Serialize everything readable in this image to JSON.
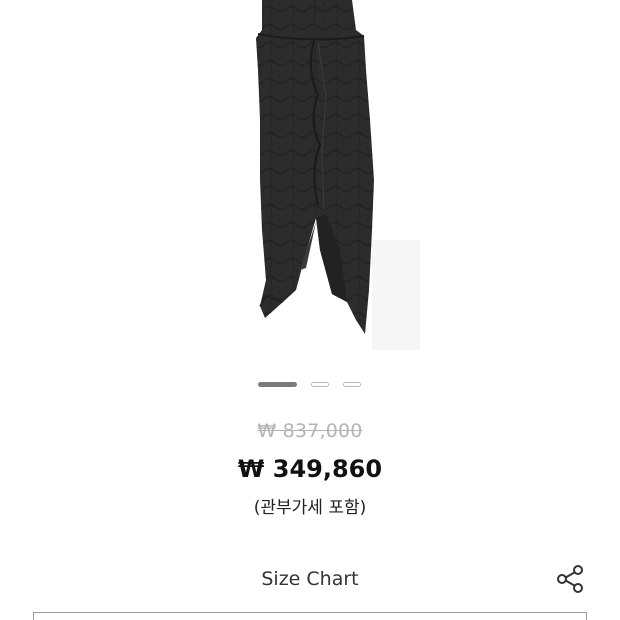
{
  "product": {
    "image_alt": "black ruched midi dress",
    "carousel": {
      "total_dots": 3,
      "active_index": 0
    }
  },
  "pricing": {
    "original_price": "₩ 837,000",
    "sale_price": "₩ 349,860",
    "note": "(관부가세 포함)"
  },
  "actions": {
    "size_chart_label": "Size Chart",
    "share_icon": "share-icon"
  },
  "colors": {
    "dress": "#2b2b2b",
    "active_dot": "#7a7a7a",
    "inactive_dot": "#b9b9b9",
    "strike_price": "#b4b4b4",
    "sale_price": "#111111"
  }
}
